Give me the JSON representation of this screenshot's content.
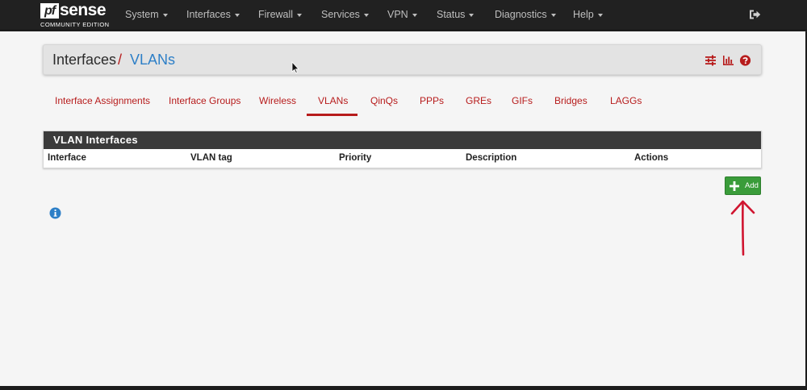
{
  "brand": {
    "pf": "pf",
    "sense": "sense",
    "edition": "COMMUNITY EDITION"
  },
  "nav": {
    "items": [
      {
        "label": "System"
      },
      {
        "label": "Interfaces"
      },
      {
        "label": "Firewall"
      },
      {
        "label": "Services"
      },
      {
        "label": "VPN"
      },
      {
        "label": "Status"
      },
      {
        "label": "Diagnostics"
      },
      {
        "label": "Help"
      }
    ],
    "logout_icon": "sign-out-icon"
  },
  "breadcrumb": {
    "parent": "Interfaces",
    "separator": "/",
    "current": "VLANs",
    "icons": [
      "sliders-icon",
      "bar-chart-icon",
      "help-circle-icon"
    ]
  },
  "tabs": [
    {
      "label": "Interface Assignments"
    },
    {
      "label": "Interface Groups"
    },
    {
      "label": "Wireless"
    },
    {
      "label": "VLANs",
      "active": true
    },
    {
      "label": "QinQs"
    },
    {
      "label": "PPPs"
    },
    {
      "label": "GREs"
    },
    {
      "label": "GIFs"
    },
    {
      "label": "Bridges"
    },
    {
      "label": "LAGGs"
    }
  ],
  "panel": {
    "title": "VLAN Interfaces",
    "columns": [
      "Interface",
      "VLAN tag",
      "Priority",
      "Description",
      "Actions"
    ]
  },
  "actions": {
    "add_label": "Add"
  },
  "colors": {
    "accent_red": "#b71c1c",
    "link_blue": "#2d7fc7",
    "add_green": "#3a9c3a",
    "navbar": "#212121"
  }
}
